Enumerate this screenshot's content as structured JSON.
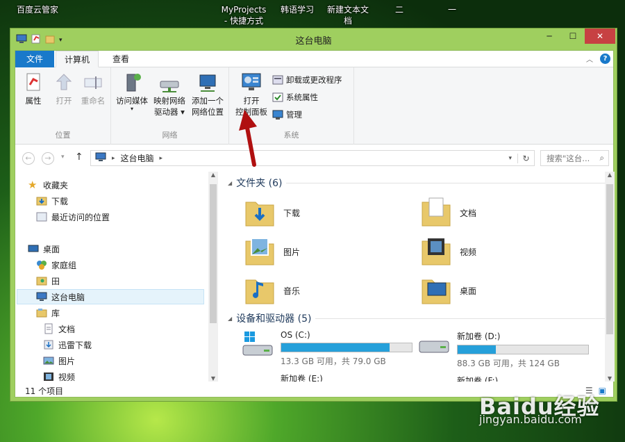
{
  "desktop": {
    "icons": [
      "百度云管家",
      "MyProjects\n- 快捷方式",
      "韩语学习",
      "新建文本文\n档",
      "二",
      "一"
    ]
  },
  "watermark": {
    "brand": "Baidu经验",
    "url": "jingyan.baidu.com"
  },
  "window": {
    "title": "这台电脑"
  },
  "tabs": {
    "file": "文件",
    "computer": "计算机",
    "view": "查看"
  },
  "ribbon": {
    "location": {
      "label": "位置",
      "properties": "属性",
      "open": "打开",
      "rename": "重命名"
    },
    "network": {
      "label": "网络",
      "media": "访问媒体",
      "map_drive_1": "映射网络",
      "map_drive_2": "驱动器 ▾",
      "add_loc_1": "添加一个",
      "add_loc_2": "网络位置"
    },
    "system": {
      "label": "系统",
      "open_cp_1": "打开",
      "open_cp_2": "控制面板",
      "uninstall": "卸载或更改程序",
      "sysprops": "系统属性",
      "manage": "管理"
    }
  },
  "address": {
    "path": "这台电脑",
    "search_placeholder": "搜索\"这台..."
  },
  "nav": {
    "favorites": "收藏夹",
    "downloads": "下载",
    "recent": "最近访问的位置",
    "desktop": "桌面",
    "homegroup": "家庭组",
    "tian": "田",
    "this_pc": "这台电脑",
    "libraries": "库",
    "docs": "文档",
    "xunlei": "迅雷下载",
    "pictures": "图片",
    "videos": "视频"
  },
  "content": {
    "folders_header": "文件夹 (6)",
    "folders": [
      "下载",
      "文档",
      "图片",
      "视频",
      "音乐",
      "桌面"
    ],
    "devices_header": "设备和驱动器 (5)",
    "drives": [
      {
        "name": "OS (C:)",
        "free": "13.3 GB 可用，共 79.0 GB",
        "used_fraction": 0.83
      },
      {
        "name": "新加卷 (D:)",
        "free": "88.3 GB 可用，共 124 GB",
        "used_fraction": 0.29
      }
    ],
    "drives_more": [
      "新加卷 (E:)",
      "新加卷 (F:)"
    ]
  },
  "status": {
    "count": "11 个项目"
  },
  "colors": {
    "accent": "#1979ca",
    "window_frame": "#9fcf5f",
    "close": "#c74142",
    "drive_bar": "#26a0da",
    "arrow": "#b01010"
  }
}
